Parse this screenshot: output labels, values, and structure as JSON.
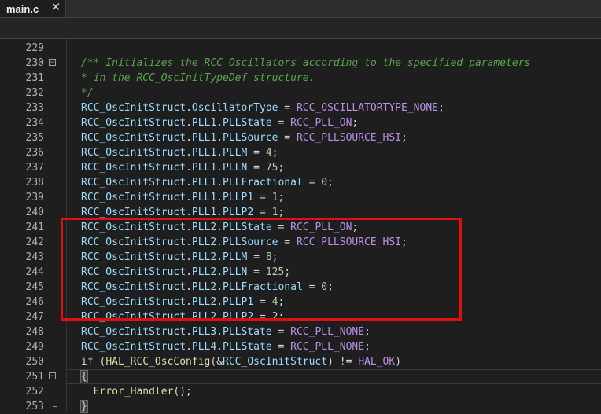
{
  "tab": {
    "label": "main.c",
    "close_glyph": "✕"
  },
  "editor": {
    "lines": [
      {
        "num": "229",
        "tokens": []
      },
      {
        "num": "230",
        "fold": "−",
        "tokens": [
          [
            "cm",
            "/** Initializes the RCC Oscillators according to the specified parameters"
          ]
        ]
      },
      {
        "num": "231",
        "tokens": [
          [
            "cm",
            "* in the RCC_OscInitTypeDef structure."
          ]
        ]
      },
      {
        "num": "232",
        "tokens": [
          [
            "cm",
            "*/"
          ]
        ]
      },
      {
        "num": "233",
        "tokens": [
          [
            "id",
            "RCC_OscInitStruct"
          ],
          [
            "op",
            "."
          ],
          [
            "id",
            "OscillatorType"
          ],
          [
            "op",
            " = "
          ],
          [
            "mc",
            "RCC_OSCILLATORTYPE_NONE"
          ],
          [
            "op",
            ";"
          ]
        ]
      },
      {
        "num": "234",
        "tokens": [
          [
            "id",
            "RCC_OscInitStruct"
          ],
          [
            "op",
            "."
          ],
          [
            "id",
            "PLL1"
          ],
          [
            "op",
            "."
          ],
          [
            "id",
            "PLLState"
          ],
          [
            "op",
            " = "
          ],
          [
            "mc",
            "RCC_PLL_ON"
          ],
          [
            "op",
            ";"
          ]
        ]
      },
      {
        "num": "235",
        "tokens": [
          [
            "id",
            "RCC_OscInitStruct"
          ],
          [
            "op",
            "."
          ],
          [
            "id",
            "PLL1"
          ],
          [
            "op",
            "."
          ],
          [
            "id",
            "PLLSource"
          ],
          [
            "op",
            " = "
          ],
          [
            "mc",
            "RCC_PLLSOURCE_HSI"
          ],
          [
            "op",
            ";"
          ]
        ]
      },
      {
        "num": "236",
        "tokens": [
          [
            "id",
            "RCC_OscInitStruct"
          ],
          [
            "op",
            "."
          ],
          [
            "id",
            "PLL1"
          ],
          [
            "op",
            "."
          ],
          [
            "id",
            "PLLM"
          ],
          [
            "op",
            " = "
          ],
          [
            "num",
            "4"
          ],
          [
            "op",
            ";"
          ]
        ]
      },
      {
        "num": "237",
        "tokens": [
          [
            "id",
            "RCC_OscInitStruct"
          ],
          [
            "op",
            "."
          ],
          [
            "id",
            "PLL1"
          ],
          [
            "op",
            "."
          ],
          [
            "id",
            "PLLN"
          ],
          [
            "op",
            " = "
          ],
          [
            "num",
            "75"
          ],
          [
            "op",
            ";"
          ]
        ]
      },
      {
        "num": "238",
        "tokens": [
          [
            "id",
            "RCC_OscInitStruct"
          ],
          [
            "op",
            "."
          ],
          [
            "id",
            "PLL1"
          ],
          [
            "op",
            "."
          ],
          [
            "id",
            "PLLFractional"
          ],
          [
            "op",
            " = "
          ],
          [
            "num",
            "0"
          ],
          [
            "op",
            ";"
          ]
        ]
      },
      {
        "num": "239",
        "tokens": [
          [
            "id",
            "RCC_OscInitStruct"
          ],
          [
            "op",
            "."
          ],
          [
            "id",
            "PLL1"
          ],
          [
            "op",
            "."
          ],
          [
            "id",
            "PLLP1"
          ],
          [
            "op",
            " = "
          ],
          [
            "num",
            "1"
          ],
          [
            "op",
            ";"
          ]
        ]
      },
      {
        "num": "240",
        "tokens": [
          [
            "id",
            "RCC_OscInitStruct"
          ],
          [
            "op",
            "."
          ],
          [
            "id",
            "PLL1"
          ],
          [
            "op",
            "."
          ],
          [
            "id",
            "PLLP2"
          ],
          [
            "op",
            " = "
          ],
          [
            "num",
            "1"
          ],
          [
            "op",
            ";"
          ]
        ]
      },
      {
        "num": "241",
        "tokens": [
          [
            "id",
            "RCC_OscInitStruct"
          ],
          [
            "op",
            "."
          ],
          [
            "id",
            "PLL2"
          ],
          [
            "op",
            "."
          ],
          [
            "id",
            "PLLState"
          ],
          [
            "op",
            " = "
          ],
          [
            "mc",
            "RCC_PLL_ON"
          ],
          [
            "op",
            ";"
          ]
        ]
      },
      {
        "num": "242",
        "tokens": [
          [
            "id",
            "RCC_OscInitStruct"
          ],
          [
            "op",
            "."
          ],
          [
            "id",
            "PLL2"
          ],
          [
            "op",
            "."
          ],
          [
            "id",
            "PLLSource"
          ],
          [
            "op",
            " = "
          ],
          [
            "mc",
            "RCC_PLLSOURCE_HSI"
          ],
          [
            "op",
            ";"
          ]
        ]
      },
      {
        "num": "243",
        "tokens": [
          [
            "id",
            "RCC_OscInitStruct"
          ],
          [
            "op",
            "."
          ],
          [
            "id",
            "PLL2"
          ],
          [
            "op",
            "."
          ],
          [
            "id",
            "PLLM"
          ],
          [
            "op",
            " = "
          ],
          [
            "num",
            "8"
          ],
          [
            "op",
            ";"
          ]
        ]
      },
      {
        "num": "244",
        "tokens": [
          [
            "id",
            "RCC_OscInitStruct"
          ],
          [
            "op",
            "."
          ],
          [
            "id",
            "PLL2"
          ],
          [
            "op",
            "."
          ],
          [
            "id",
            "PLLN"
          ],
          [
            "op",
            " = "
          ],
          [
            "num",
            "125"
          ],
          [
            "op",
            ";"
          ]
        ]
      },
      {
        "num": "245",
        "tokens": [
          [
            "id",
            "RCC_OscInitStruct"
          ],
          [
            "op",
            "."
          ],
          [
            "id",
            "PLL2"
          ],
          [
            "op",
            "."
          ],
          [
            "id",
            "PLLFractional"
          ],
          [
            "op",
            " = "
          ],
          [
            "num",
            "0"
          ],
          [
            "op",
            ";"
          ]
        ]
      },
      {
        "num": "246",
        "tokens": [
          [
            "id",
            "RCC_OscInitStruct"
          ],
          [
            "op",
            "."
          ],
          [
            "id",
            "PLL2"
          ],
          [
            "op",
            "."
          ],
          [
            "id",
            "PLLP1"
          ],
          [
            "op",
            " = "
          ],
          [
            "num",
            "4"
          ],
          [
            "op",
            ";"
          ]
        ]
      },
      {
        "num": "247",
        "tokens": [
          [
            "id",
            "RCC_OscInitStruct"
          ],
          [
            "op",
            "."
          ],
          [
            "id",
            "PLL2"
          ],
          [
            "op",
            "."
          ],
          [
            "id",
            "PLLP2"
          ],
          [
            "op",
            " = "
          ],
          [
            "num",
            "2"
          ],
          [
            "op",
            ";"
          ]
        ]
      },
      {
        "num": "248",
        "tokens": [
          [
            "id",
            "RCC_OscInitStruct"
          ],
          [
            "op",
            "."
          ],
          [
            "id",
            "PLL3"
          ],
          [
            "op",
            "."
          ],
          [
            "id",
            "PLLState"
          ],
          [
            "op",
            " = "
          ],
          [
            "mc",
            "RCC_PLL_NONE"
          ],
          [
            "op",
            ";"
          ]
        ]
      },
      {
        "num": "249",
        "tokens": [
          [
            "id",
            "RCC_OscInitStruct"
          ],
          [
            "op",
            "."
          ],
          [
            "id",
            "PLL4"
          ],
          [
            "op",
            "."
          ],
          [
            "id",
            "PLLState"
          ],
          [
            "op",
            " = "
          ],
          [
            "mc",
            "RCC_PLL_NONE"
          ],
          [
            "op",
            ";"
          ]
        ]
      },
      {
        "num": "250",
        "tokens": [
          [
            "kw",
            "if"
          ],
          [
            "op",
            " ("
          ],
          [
            "fn",
            "HAL_RCC_OscConfig"
          ],
          [
            "op",
            "(&"
          ],
          [
            "id",
            "RCC_OscInitStruct"
          ],
          [
            "op",
            ") != "
          ],
          [
            "mc",
            "HAL_OK"
          ],
          [
            "op",
            ")"
          ]
        ]
      },
      {
        "num": "251",
        "fold": "−",
        "current": true,
        "tokens": [
          [
            "brace",
            "{"
          ]
        ]
      },
      {
        "num": "252",
        "tokens": [
          [
            "op",
            "  "
          ],
          [
            "fn",
            "Error_Handler"
          ],
          [
            "op",
            "();"
          ]
        ]
      },
      {
        "num": "253",
        "tokens": [
          [
            "brace",
            "}"
          ]
        ]
      }
    ]
  },
  "annotation": {
    "color": "#e01010",
    "from_line": "241",
    "to_line": "247"
  }
}
